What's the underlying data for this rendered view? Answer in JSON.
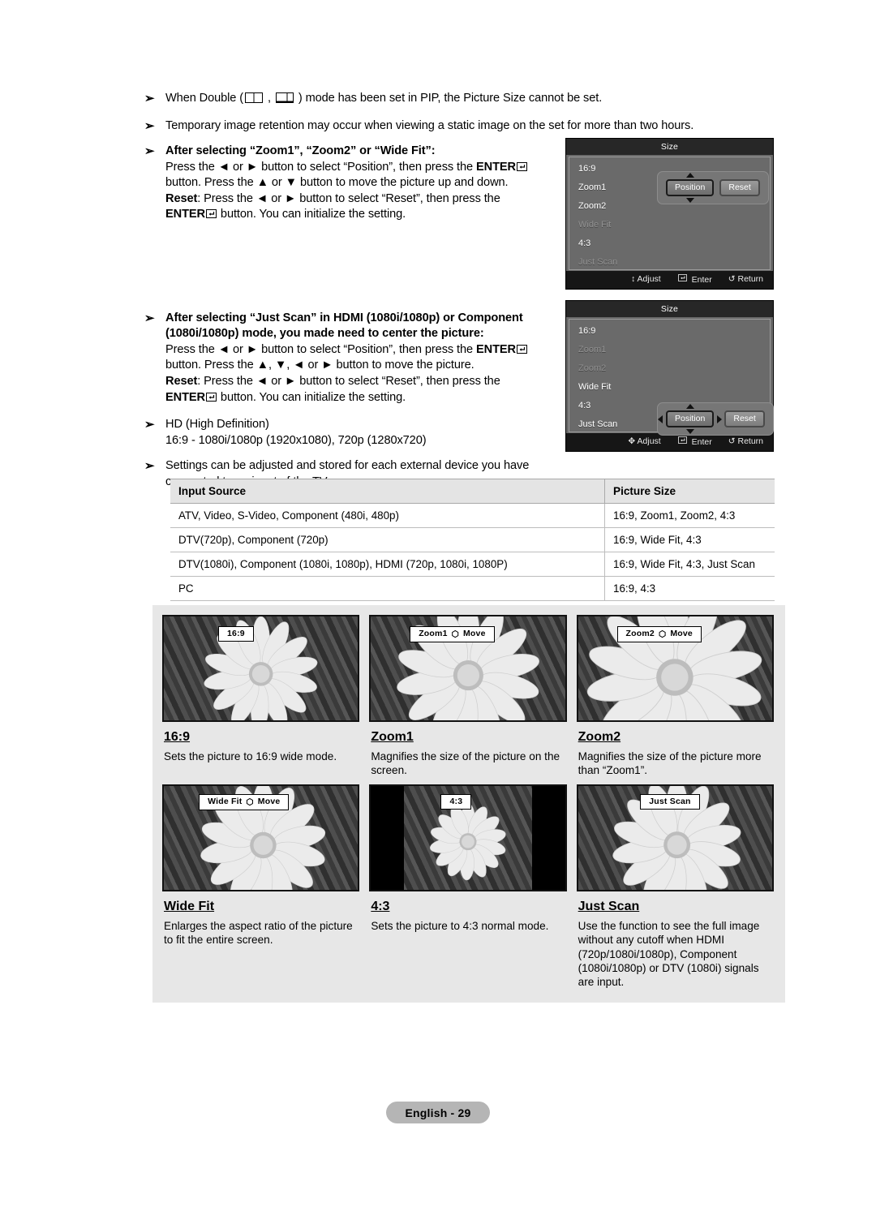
{
  "bullets": [
    {
      "id": "pip-double",
      "marker": "➢",
      "pre": "When Double (",
      "mid": " , ",
      "post": " ) mode has been set in PIP, the Picture Size cannot be set.",
      "icons": [
        "pip-double-wide-icon",
        "pip-double-narrow-icon"
      ]
    },
    {
      "id": "image-retention",
      "marker": "➢",
      "text": "Temporary image retention may occur when viewing a static image on the set for more than two hours."
    },
    {
      "id": "after-zoom",
      "marker": "➢",
      "heading": "After selecting “Zoom1”, “Zoom2” or “Wide Fit”:",
      "line1a": "Press the ",
      "line1b": " or ",
      "line1c": " button to select “Position”, then press the ",
      "enter_label": "ENTER",
      "line2": "button. Press the ",
      "line2b": " or ",
      "line2c": " button to move the picture up and down.",
      "reset_label": "Reset",
      "line3a": ": Press the ",
      "line3b": " or ",
      "line3c": " button to select “Reset”, then press the",
      "line4": " button. You can initialize the setting."
    },
    {
      "id": "after-just-scan",
      "marker": "➢",
      "heading1": "After selecting “Just Scan” in HDMI (1080i/1080p) or Component",
      "heading2": "(1080i/1080p) mode, you made need to center the picture:",
      "line1a": "Press the ",
      "line1b": " or ",
      "line1c": " button to select “Position”, then press the ",
      "enter_label": "ENTER",
      "line2a": "button. Press the ",
      "line2b": ", ",
      "line2c": ", ",
      "line2d": " or ",
      "line2e": " button to move the picture.",
      "reset_label": "Reset",
      "line3a": ": Press the ",
      "line3b": " or ",
      "line3c": " button to select “Reset”, then press the",
      "line4": " button. You can initialize the setting."
    },
    {
      "id": "hd-definition",
      "marker": "➢",
      "line1": "HD (High Definition)",
      "line2": "16:9 - 1080i/1080p (1920x1080), 720p (1280x720)"
    },
    {
      "id": "settings-stored",
      "marker": "➢",
      "line1": "Settings can be adjusted and stored for each external device you have",
      "line2": "connected to an input of the TV."
    }
  ],
  "osd_panels": [
    {
      "id": "osd-zoom",
      "title": "Size",
      "items": [
        {
          "label": "16:9",
          "dim": false
        },
        {
          "label": "Zoom1",
          "dim": false
        },
        {
          "label": "Zoom2",
          "dim": false
        },
        {
          "label": "Wide Fit",
          "dim": true
        },
        {
          "label": "4:3",
          "dim": false
        },
        {
          "label": "Just Scan",
          "dim": true
        }
      ],
      "position_button": "Position",
      "reset_button": "Reset",
      "footer": [
        {
          "icon": "updown-arrow-icon",
          "label": "Adjust"
        },
        {
          "icon": "enter-icon",
          "label": "Enter"
        },
        {
          "icon": "return-icon",
          "label": "Return"
        }
      ]
    },
    {
      "id": "osd-just-scan",
      "title": "Size",
      "items": [
        {
          "label": "16:9",
          "dim": false
        },
        {
          "label": "Zoom1",
          "dim": true
        },
        {
          "label": "Zoom2",
          "dim": true
        },
        {
          "label": "Wide Fit",
          "dim": false
        },
        {
          "label": "4:3",
          "dim": false
        },
        {
          "label": "Just Scan",
          "dim": false
        }
      ],
      "position_button": "Position",
      "reset_button": "Reset",
      "footer": [
        {
          "icon": "fourway-arrow-icon",
          "label": "Adjust"
        },
        {
          "icon": "enter-icon",
          "label": "Enter"
        },
        {
          "icon": "return-icon",
          "label": "Return"
        }
      ]
    }
  ],
  "table": {
    "headers": [
      "Input Source",
      "Picture Size"
    ],
    "rows": [
      [
        "ATV, Video, S-Video, Component (480i, 480p)",
        "16:9, Zoom1, Zoom2, 4:3"
      ],
      [
        "DTV(720p), Component (720p)",
        "16:9, Wide Fit, 4:3"
      ],
      [
        "DTV(1080i), Component (1080i, 1080p), HDMI (720p, 1080i, 1080P)",
        "16:9, Wide Fit, 4:3, Just Scan"
      ],
      [
        "PC",
        "16:9, 4:3"
      ]
    ]
  },
  "gallery": [
    {
      "id": "mode-16-9",
      "overlay": "16:9",
      "overlay_has_move": false,
      "title": "16:9",
      "text": "Sets the picture to 16:9 wide mode.",
      "pillarbox": false
    },
    {
      "id": "mode-zoom1",
      "overlay": "Zoom1",
      "overlay_move": "Move",
      "overlay_has_move": true,
      "title": "Zoom1",
      "text": "Magnifies the size of the picture on the screen.",
      "pillarbox": false
    },
    {
      "id": "mode-zoom2",
      "overlay": "Zoom2",
      "overlay_move": "Move",
      "overlay_has_move": true,
      "title": "Zoom2",
      "text": "Magnifies the size of the picture more than “Zoom1”.",
      "pillarbox": false
    },
    {
      "id": "mode-wide-fit",
      "overlay": "Wide Fit",
      "overlay_move": "Move",
      "overlay_has_move": true,
      "title": "Wide Fit",
      "text": "Enlarges the aspect ratio of the picture to fit the entire screen.",
      "pillarbox": false
    },
    {
      "id": "mode-4-3",
      "overlay": "4:3",
      "overlay_has_move": false,
      "title": "4:3",
      "text": "Sets the picture to 4:3 normal mode.",
      "pillarbox": true
    },
    {
      "id": "mode-just-scan",
      "overlay": "Just Scan",
      "overlay_has_move": false,
      "title": "Just Scan",
      "text": "Use the function to see the full image without any cutoff when HDMI (720p/1080i/1080p), Component (1080i/1080p) or DTV (1080i) signals are input.",
      "pillarbox": false
    }
  ],
  "footer": {
    "page_label": "English - 29"
  }
}
